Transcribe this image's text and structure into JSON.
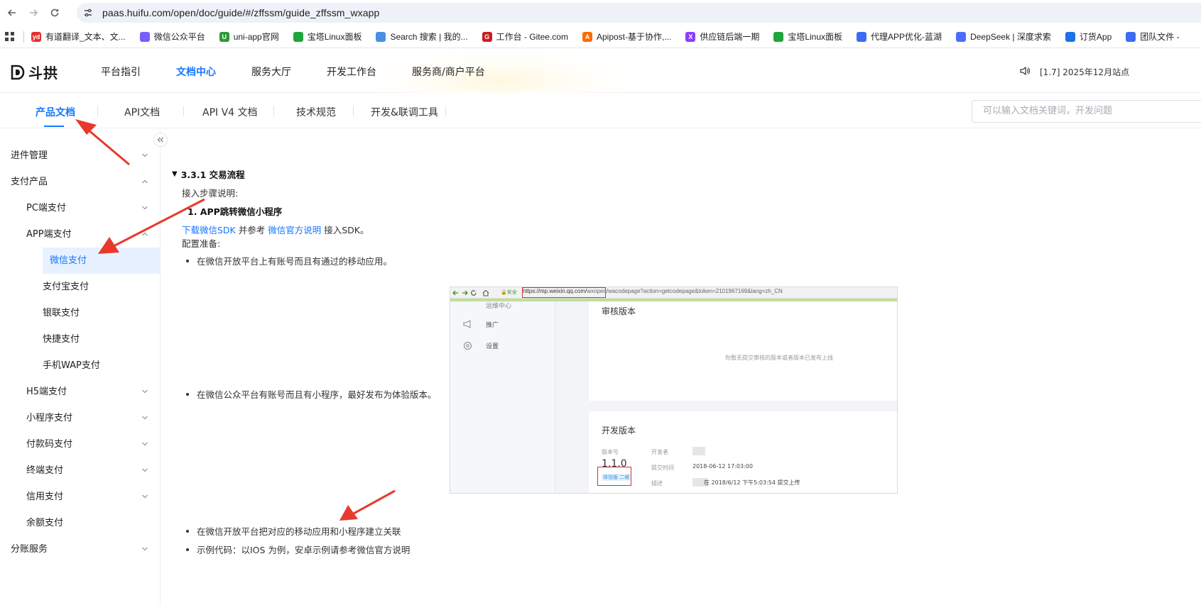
{
  "browser": {
    "url": "paas.huifu.com/open/doc/guide/#/zffssm/guide_zffssm_wxapp",
    "bookmarks": [
      {
        "label": "有道翻译_文本、文...",
        "color": "#e0312f",
        "glyph": "yd"
      },
      {
        "label": "微信公众平台",
        "color": "#7b5cff",
        "glyph": ""
      },
      {
        "label": "uni-app官网",
        "color": "#2b9939",
        "glyph": "U"
      },
      {
        "label": "宝塔Linux面板",
        "color": "#20a53a",
        "glyph": ""
      },
      {
        "label": "Search 搜索 | 我的...",
        "color": "#4a90e2",
        "glyph": ""
      },
      {
        "label": "工作台 - Gitee.com",
        "color": "#c71d23",
        "glyph": "G"
      },
      {
        "label": "Apipost-基于协作,...",
        "color": "#ff6a00",
        "glyph": "A"
      },
      {
        "label": "供应链后端一期",
        "color": "#8a3ffc",
        "glyph": "X"
      },
      {
        "label": "宝塔Linux面板",
        "color": "#20a53a",
        "glyph": ""
      },
      {
        "label": "代理APP优化-蓝湖",
        "color": "#3d6cf4",
        "glyph": ""
      },
      {
        "label": "DeepSeek | 深度求索",
        "color": "#4d6bfe",
        "glyph": ""
      },
      {
        "label": "订货App",
        "color": "#1a73e8",
        "glyph": ""
      },
      {
        "label": "团队文件 -",
        "color": "#3d6cf4",
        "glyph": ""
      }
    ]
  },
  "header": {
    "logo": "斗拱",
    "nav": [
      "平台指引",
      "文档中心",
      "服务大厅",
      "开发工作台",
      "服务商/商户平台"
    ],
    "active_nav": "文档中心",
    "notice": "[1.7] 2025年12月站点"
  },
  "subnav": {
    "tabs": [
      "产品文档",
      "API文档",
      "API V4 文档",
      "技术规范",
      "开发&联调工具"
    ],
    "active": "产品文档",
    "search_placeholder": "可以输入文档关键词，开发问题"
  },
  "sidebar": {
    "items": [
      {
        "label": "进件管理",
        "level": 0,
        "state": "collapsed"
      },
      {
        "label": "支付产品",
        "level": 0,
        "state": "expanded"
      },
      {
        "label": "PC端支付",
        "level": 1,
        "state": "collapsed"
      },
      {
        "label": "APP端支付",
        "level": 1,
        "state": "expanded"
      },
      {
        "label": "微信支付",
        "level": 2,
        "state": "active"
      },
      {
        "label": "支付宝支付",
        "level": 2,
        "state": ""
      },
      {
        "label": "银联支付",
        "level": 2,
        "state": ""
      },
      {
        "label": "快捷支付",
        "level": 2,
        "state": ""
      },
      {
        "label": "手机WAP支付",
        "level": 2,
        "state": ""
      },
      {
        "label": "H5端支付",
        "level": 1,
        "state": "collapsed"
      },
      {
        "label": "小程序支付",
        "level": 1,
        "state": "collapsed"
      },
      {
        "label": "付款码支付",
        "level": 1,
        "state": "collapsed"
      },
      {
        "label": "终端支付",
        "level": 1,
        "state": "collapsed"
      },
      {
        "label": "信用支付",
        "level": 1,
        "state": "collapsed"
      },
      {
        "label": "余额支付",
        "level": 1,
        "state": ""
      },
      {
        "label": "分账服务",
        "level": 0,
        "state": "collapsed"
      }
    ]
  },
  "content": {
    "section_title": "3.3.1 交易流程",
    "intro": "接入步骤说明:",
    "step1": "1. APP跳转微信小程序",
    "sdk_link": "下载微信SDK",
    "sdk_mid": " 并参考 ",
    "official_link": "微信官方说明",
    "sdk_end": " 接入SDK。",
    "config": "配置准备:",
    "bullets": [
      "在微信开放平台上有账号而且有通过的移动应用。",
      "在微信公众平台有账号而且有小程序，最好发布为体验版本。",
      "在微信开放平台把对应的移动应用和小程序建立关联",
      "示例代码：以IOS 为例，安卓示例请参考微信官方说明"
    ]
  },
  "embedded_screenshot": {
    "url_highlight": "https://mp.weixin.qq.com/",
    "url_rest": "wxopen/wacodepage?action=getcodepage&token=2101967169&lang=zh_CN",
    "secure_label": "安全",
    "side_items": [
      "运维中心",
      "推广",
      "设置"
    ],
    "review_title": "审核版本",
    "review_empty": "你暂无提交审核的版本或者版本已发布上线",
    "dev_title": "开发版本",
    "version_label": "版本号",
    "version_value": "1.1.0",
    "developer_label": "开发者",
    "submit_time_label": "提交时间",
    "submit_time_value": "2018-06-12 17:03:00",
    "desc_label": "描述",
    "desc_value": "在 2018/6/12 下午5:03:54 提交上传",
    "trial_badge": "体验版 二维"
  },
  "colors": {
    "accent": "#1476ff",
    "annotation_arrow": "#e8392c"
  }
}
